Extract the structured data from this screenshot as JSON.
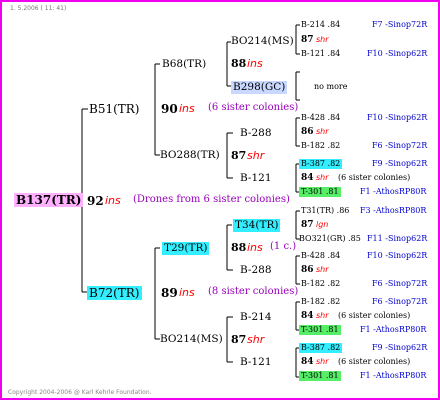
{
  "header": {
    "date_line": "1. 5.2006 ( 11: 41)"
  },
  "footer": {
    "copyright": "Copyright 2004-2006 @ Karl Kehrle Foundation."
  },
  "root": {
    "label": "B137(TR)",
    "year": "92",
    "ins": "ins",
    "note": "(Drones from 6 sister colonies)"
  },
  "g1": {
    "top": {
      "label": "B51(TR)",
      "year": "90",
      "ins": "ins",
      "note": "(6 sister colonies)"
    },
    "bottom": {
      "label": "B72(TR)",
      "year": "89",
      "ins": "ins",
      "note": "(8 sister colonies)"
    }
  },
  "g2": {
    "b68": {
      "label": "B68(TR)"
    },
    "bo288": {
      "label": "BO288(TR)",
      "year": "87",
      "ins": "shr"
    },
    "t29": {
      "label": "T29(TR)",
      "year": "88",
      "ins": "ins",
      "note": "(1 c.)"
    },
    "bo214": {
      "label": "BO214(MS)",
      "year": "87",
      "ins": "shr"
    }
  },
  "g3": {
    "bo214ms": {
      "label": "BO214(MS)",
      "year": "88",
      "ins": "ins"
    },
    "b298": {
      "label": "B298(GC)",
      "note": "no more"
    },
    "b288a": {
      "label": "B-288",
      "year": "86",
      "ins": "shr"
    },
    "b121a": {
      "label": "B-121",
      "year": "84",
      "ins": "shr",
      "note": "(6 sister colonies)"
    },
    "t34": {
      "label": "T34(TR)",
      "year": "88",
      "ins": "ins"
    },
    "b288b": {
      "label": "B-288",
      "year": "86",
      "ins": "shr"
    },
    "b214": {
      "label": "B-214",
      "year": "84",
      "ins": "shr",
      "note": "(6 sister colonies)"
    },
    "b121b": {
      "label": "B-121",
      "year": "84",
      "ins": "shr",
      "note": "(6 sister colonies)"
    }
  },
  "g4": [
    {
      "label": "B-214 .84",
      "src": "F7 -Sinop72R"
    },
    {
      "year": "87",
      "ins": "shr"
    },
    {
      "label": "B-121 .84",
      "src": "F10 -Sinop62R"
    },
    {
      "label": "B-428 .84",
      "src": "F10 -Sinop62R"
    },
    {
      "year": "86",
      "ins": "shr"
    },
    {
      "label": "B-182 .82",
      "src": "F6 -Sinop72R"
    },
    {
      "label": "B-387 .82",
      "src": "F9 -Sinop62R"
    },
    {
      "year": "84",
      "ins": "shr",
      "note": "(6 sister colonies)"
    },
    {
      "label": "T-301 .81",
      "src": "F1 -AthosRP80R"
    },
    {
      "label": "T31(TR) .86",
      "src": "F3 -AthosRP80R"
    },
    {
      "year": "87",
      "ins": "lgn"
    },
    {
      "label": "BO321(GR) .85",
      "src": "F11 -Sinop62R"
    },
    {
      "label": "B-428 .84",
      "src": "F10 -Sinop62R"
    },
    {
      "year": "86",
      "ins": "shr"
    },
    {
      "label": "B-182 .82",
      "src": "F6 -Sinop72R"
    },
    {
      "label": "B-182 .82",
      "src": "F6 -Sinop72R"
    },
    {
      "year": "84",
      "ins": "shr",
      "note": "(6 sister colonies)"
    },
    {
      "label": "T-301 .81",
      "src": "F1 -AthosRP80R"
    },
    {
      "label": "B-387 .82",
      "src": "F9 -Sinop62R"
    },
    {
      "year": "84",
      "ins": "shr",
      "note": "(6 sister colonies)"
    },
    {
      "label": "T-301 .81",
      "src": "F1 -AthosRP80R"
    }
  ]
}
